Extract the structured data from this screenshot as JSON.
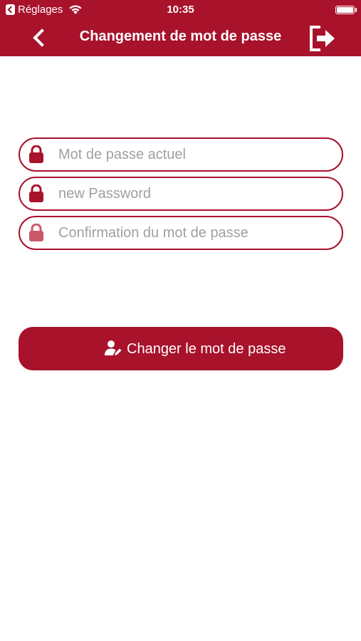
{
  "status_bar": {
    "carrier": "Réglages",
    "time": "10:35"
  },
  "nav": {
    "title": "Changement de mot de passe",
    "back_icon": "chevron-left-icon",
    "logout_icon": "logout-icon"
  },
  "form": {
    "current_password": {
      "placeholder": "Mot de passe actuel",
      "value": ""
    },
    "new_password": {
      "placeholder": "new Password",
      "value": ""
    },
    "confirm_password": {
      "placeholder": "Confirmation du mot de passe",
      "value": ""
    }
  },
  "submit": {
    "label": "Changer le mot de passe",
    "icon": "user-edit-icon"
  },
  "colors": {
    "primary": "#A8122B",
    "lock_disabled": "#C9586B",
    "placeholder": "#A0A0A0"
  }
}
